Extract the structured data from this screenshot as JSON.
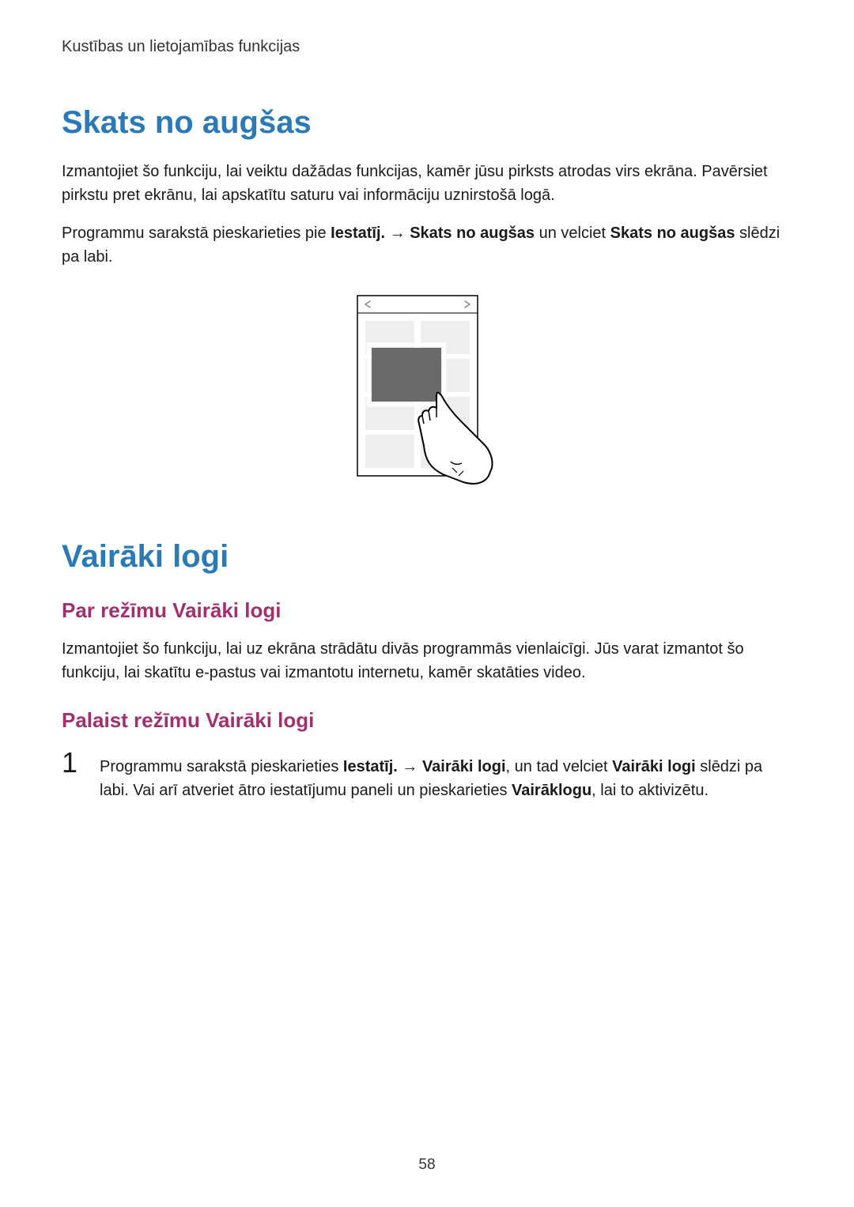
{
  "breadcrumb": "Kustības un lietojamības funkcijas",
  "section1": {
    "heading": "Skats no augšas",
    "p1": "Izmantojiet šo funkciju, lai veiktu dažādas funkcijas, kamēr jūsu pirksts atrodas virs ekrāna. Pavērsiet pirkstu pret ekrānu, lai apskatītu saturu vai informāciju uznirstošā logā.",
    "p2_pre": "Programmu sarakstā pieskarieties pie ",
    "p2_b1": "Iestatīj.",
    "p2_arrow": " → ",
    "p2_b2": "Skats no augšas",
    "p2_mid": " un velciet ",
    "p2_b3": "Skats no augšas",
    "p2_post": " slēdzi pa labi."
  },
  "section2": {
    "heading": "Vairāki logi",
    "sub1": {
      "heading": "Par režīmu Vairāki logi",
      "p1": "Izmantojiet šo funkciju, lai uz ekrāna strādātu divās programmās vienlaicīgi. Jūs varat izmantot šo funkciju, lai skatītu e-pastus vai izmantotu internetu, kamēr skatāties video."
    },
    "sub2": {
      "heading": "Palaist režīmu Vairāki logi",
      "step1": {
        "num": "1",
        "pre": "Programmu sarakstā pieskarieties ",
        "b1": "Iestatīj.",
        "arrow": " → ",
        "b2": "Vairāki logi",
        "mid1": ", un tad velciet ",
        "b3": "Vairāki logi",
        "mid2": " slēdzi pa labi. Vai arī atveriet ātro iestatījumu paneli un pieskarieties ",
        "b4": "Vairāklogu",
        "post": ", lai to aktivizētu."
      }
    }
  },
  "pageNumber": "58"
}
